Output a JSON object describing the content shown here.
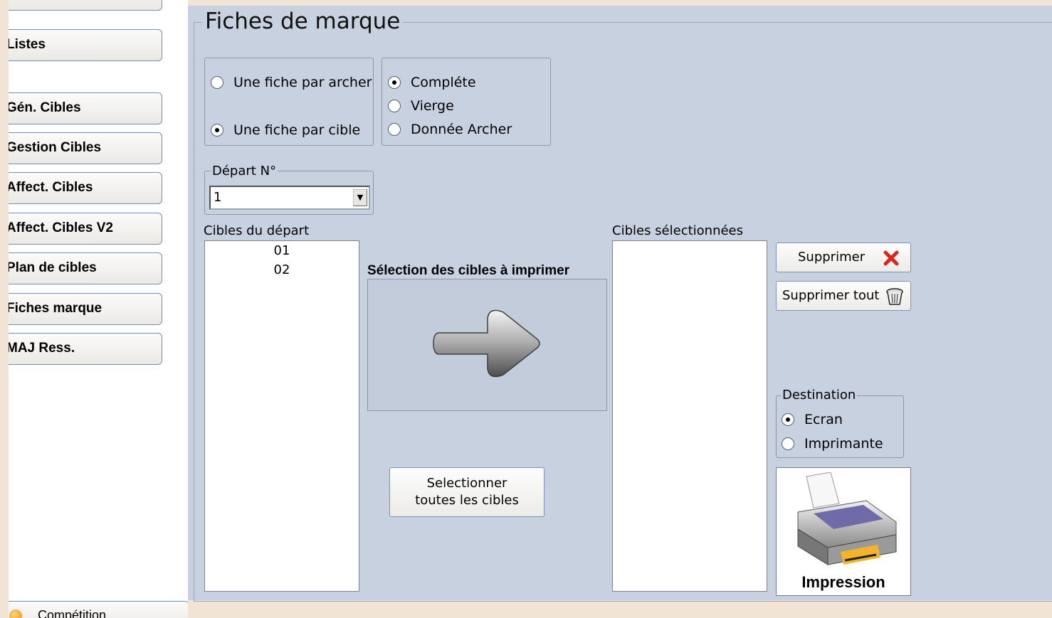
{
  "sidebar": {
    "items": [
      {
        "label": "Listes"
      },
      {
        "label": "Gén. Cibles"
      },
      {
        "label": "Gestion Cibles"
      },
      {
        "label": "Affect. Cibles"
      },
      {
        "label": "Affect. Cibles V2"
      },
      {
        "label": "Plan de cibles"
      },
      {
        "label": "Fiches marque"
      },
      {
        "label": "MAJ Ress."
      }
    ],
    "competition_label": "Compétition"
  },
  "title": "Fiches de marque",
  "mode_group": {
    "options": [
      {
        "label": "Une fiche par archer",
        "checked": false
      },
      {
        "label": "Une fiche par cible",
        "checked": true
      }
    ]
  },
  "content_group": {
    "options": [
      {
        "label": "Compléte",
        "checked": true
      },
      {
        "label": "Vierge",
        "checked": false
      },
      {
        "label": "Donnée Archer",
        "checked": false
      }
    ]
  },
  "depart": {
    "legend": "Départ N°",
    "value": "1"
  },
  "source_list": {
    "label": "Cibles du départ",
    "items": [
      "01",
      "02"
    ]
  },
  "selection": {
    "label": "Sélection des cibles à imprimer",
    "icon": "right-arrow-icon"
  },
  "select_all_button": {
    "line1": "Selectionner",
    "line2": "toutes les cibles"
  },
  "target_list": {
    "label": "Cibles sélectionnées",
    "items": []
  },
  "remove_button": {
    "label": "Supprimer",
    "icon": "red-x-icon",
    "color": "#d9261c"
  },
  "remove_all_button": {
    "label": "Supprimer tout",
    "icon": "trash-icon"
  },
  "destination": {
    "legend": "Destination",
    "options": [
      {
        "label": "Ecran",
        "checked": true
      },
      {
        "label": "Imprimante",
        "checked": false
      }
    ]
  },
  "print_button": {
    "label": "Impression",
    "icon": "printer-icon"
  }
}
